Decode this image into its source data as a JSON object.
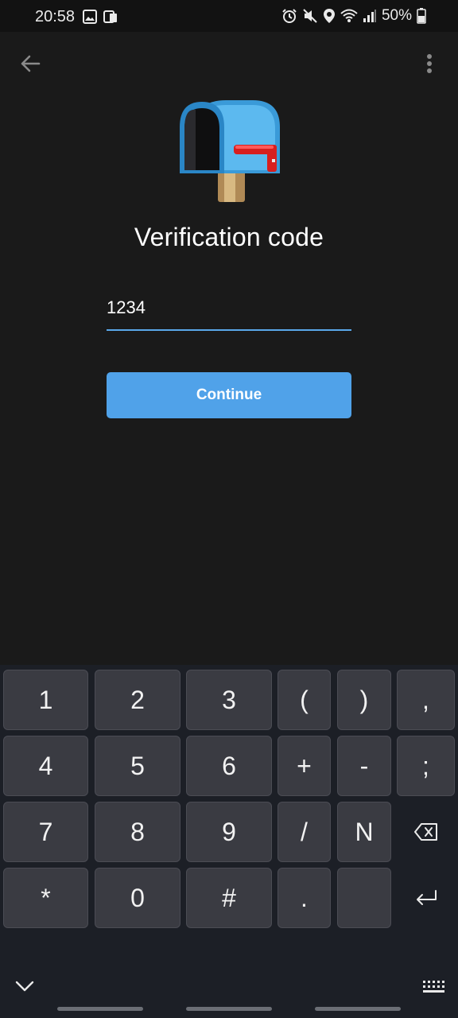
{
  "status": {
    "time": "20:58",
    "battery": "50%"
  },
  "page": {
    "title": "Verification code",
    "code_value": "1234",
    "continue_label": "Continue"
  },
  "keyboard": {
    "rows": [
      [
        "1",
        "2",
        "3",
        "(",
        ")",
        ","
      ],
      [
        "4",
        "5",
        "6",
        "+",
        "-",
        ";"
      ],
      [
        "7",
        "8",
        "9",
        "/",
        "N",
        ""
      ],
      [
        "*",
        "0",
        "#",
        ".",
        "",
        ""
      ]
    ]
  },
  "colors": {
    "accent": "#50a2e9",
    "background": "#1a1a1a",
    "keyboard": "#1c1f26",
    "key": "#3a3b42"
  },
  "icons": [
    "back-arrow-icon",
    "more-vertical-icon",
    "mailbox-icon",
    "backspace-icon",
    "enter-icon",
    "keyboard-hide-icon",
    "keyboard-icon"
  ]
}
